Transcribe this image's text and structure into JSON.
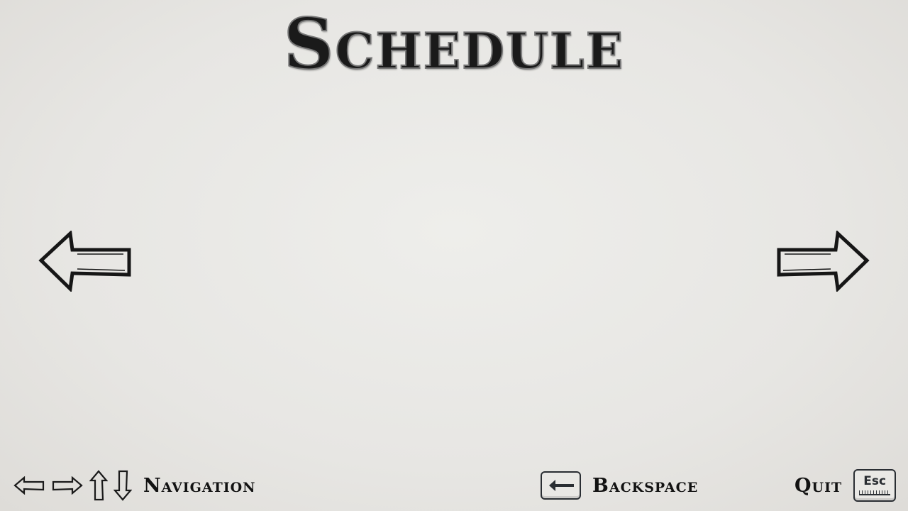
{
  "screen": {
    "title": "Schedule"
  },
  "pager": {
    "prev_icon": "left-arrow-icon",
    "next_icon": "right-arrow-icon"
  },
  "controls": {
    "navigation": {
      "label": "Navigation",
      "icons": [
        "left-arrow-icon",
        "right-arrow-icon",
        "up-arrow-icon",
        "down-arrow-icon"
      ]
    },
    "backspace": {
      "label": "Backspace",
      "key_icon": "backspace-key-icon"
    },
    "quit": {
      "label": "Quit",
      "key_label": "Esc"
    }
  },
  "colors": {
    "ink": "#141414",
    "paper": "#e8e7e4",
    "key_outline": "#2a2e33"
  }
}
